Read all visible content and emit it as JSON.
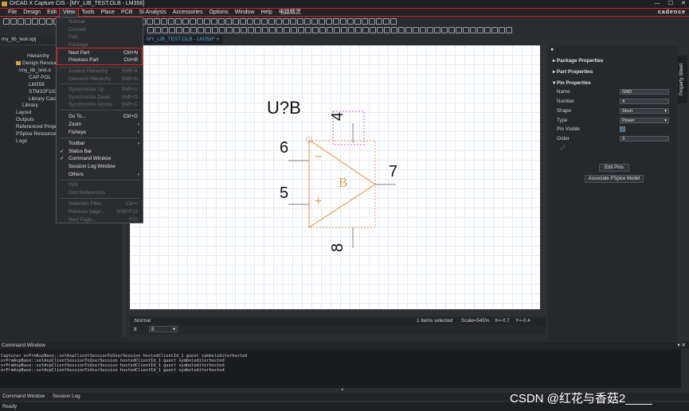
{
  "window": {
    "title": "OrCAD X Capture CIS - [MY_LIB_TEST.OLB - LM358]",
    "brand": "cadence"
  },
  "menubar": [
    "File",
    "Design",
    "Edit",
    "View",
    "Tools",
    "Place",
    "PCB",
    "SI Analysis",
    "Accessories",
    "Options",
    "Window",
    "Help",
    "电路精灵"
  ],
  "view_menu": {
    "normal": "Normal",
    "convert": "Convert",
    "part": "Part",
    "package": "Package",
    "next_part": "Next Part",
    "next_part_sc": "Ctrl+N",
    "previous_part": "Previous Part",
    "previous_part_sc": "Ctrl+B",
    "ascend": "Ascend Hierarchy",
    "ascend_sc": "Shift+A",
    "descend": "Descend Hierarchy",
    "descend_sc": "Shift+D",
    "sync_up": "Synchronize Up",
    "sync_up_sc": "Shift+U",
    "sync_down": "Synchronize Down",
    "sync_down_sc": "Shift+O",
    "sync_across": "Synchronize Across",
    "sync_across_sc": "Shift+C",
    "goto": "Go To...",
    "goto_sc": "Ctrl+G",
    "zoom": "Zoom",
    "fisheye": "Fisheye",
    "toolbar": "Toolbar",
    "status_bar": "Status Bar",
    "command_window": "Command Window",
    "session_log": "Session Log Window",
    "others": "Others",
    "grid": "Grid",
    "grid_refs": "Grid References",
    "selection_filter": "Selection Filter",
    "selection_filter_sc": "Ctrl+I",
    "previous_page": "Previous page...",
    "previous_page_sc": "Shift+F10",
    "next_page": "Next Page...",
    "next_page_sc": "F10"
  },
  "left_panel": {
    "project_file": "my_lib_test.opj",
    "hierarchy_tab": "Hierarchy",
    "tree": [
      "Design Resources",
      ".\\my_lib_test.o",
      "CAP POL",
      "LM358",
      "STM32F103",
      "Library Cach",
      "Library",
      "Layout",
      "Outputs",
      "Referenced Proje",
      "PSpice Resources",
      "Logs"
    ]
  },
  "tab": {
    "label": "MY_LIB_TEST.OLB - LM358*",
    "close": "×"
  },
  "part": {
    "refdes": "U?B",
    "pin_inv": "6",
    "pin_noninv": "5",
    "pin_out": "7",
    "pin_vcc": "4",
    "pin_gnd": "8",
    "minus": "−",
    "plus": "+",
    "section": "B"
  },
  "editor_status": {
    "mode": ".Normal",
    "selected": "1 items selected",
    "scale": "Scale=545%",
    "x": "X=-0.7",
    "y": "Y=-0.4",
    "grid_a": "8",
    "grid_b": "8"
  },
  "properties": {
    "package": "Package Properties",
    "part": "Part Properties",
    "pin": "Pin Properties",
    "name_l": "Name",
    "name_v": "GND",
    "number_l": "Number",
    "number_v": "4",
    "shape_l": "Shape",
    "shape_v": "Short",
    "type_l": "Type",
    "type_v": "Power",
    "visible_l": "Pin Visible",
    "order_l": "Order",
    "order_v": "3",
    "edit_pins": "Edit Pins",
    "assoc_pspice": "Associate PSpice Model",
    "sheet_tab": "Property Sheet"
  },
  "command_window": {
    "title": "Command Window",
    "lines": [
      "Capture> orPrmAspBase::setAspClientSessionToUserSession hostedClientId_1 guest symboleditorhosted",
      "orPrmAspBase::setAspClientSessionToUserSession hostedClientId_1 guest symboleditorhosted",
      "orPrmAspBase::setAspClientSessionToUserSession hostedClientId_1 guest symboleditorhosted",
      "orPrmAspBase::setAspClientSessionToUserSession hostedClientId_1 guest symboleditorhosted"
    ],
    "tab1": "Command Window",
    "tab2": "Session Log"
  },
  "status": "Ready",
  "watermark": "CSDN @红花与香菇2____"
}
